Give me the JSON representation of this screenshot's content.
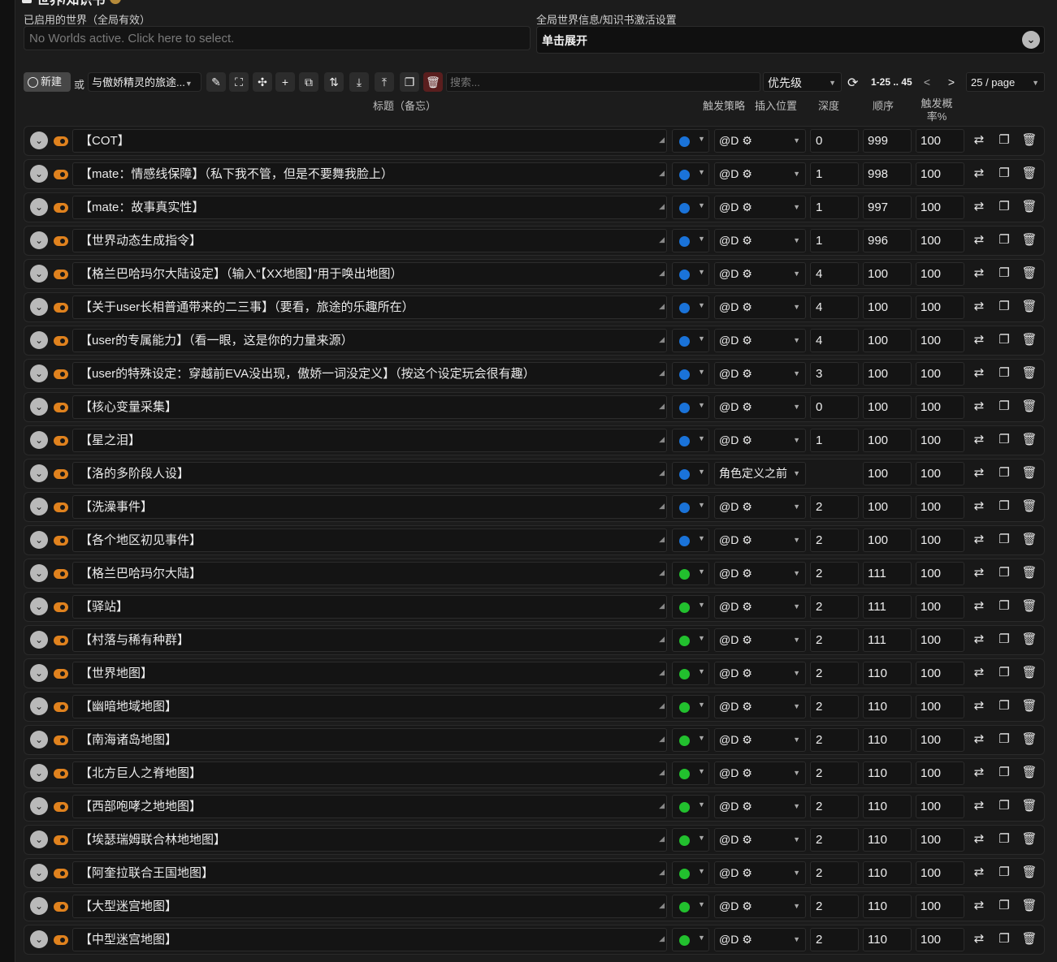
{
  "header": {
    "title_partial": "世界/知识书"
  },
  "active_worlds": {
    "label": "已启用的世界（全局有效）",
    "placeholder": "No Worlds active. Click here to select."
  },
  "global_settings": {
    "label": "全局世界信息/知识书激活设置",
    "expand_text": "单击展开"
  },
  "toolbar": {
    "new_label": "新建",
    "or_label": "或",
    "book_selected": "与傲娇精灵的旅途...",
    "search_placeholder": "搜索...",
    "sort_value": "优先级",
    "range": "1-25 .. 45",
    "prev": "<",
    "next": ">",
    "per_page": "25 / page"
  },
  "columns": {
    "title": "标题（备忘）",
    "strategy": "触发策略",
    "position": "插入位置",
    "depth": "深度",
    "order": "顺序",
    "probability": "触发概率%"
  },
  "colors": {
    "blue": "#1a73d9",
    "green": "#22c02e",
    "accent_orange": "#e0821e"
  },
  "entries": [
    {
      "title": "【COT】",
      "strategy": "blue",
      "position": "@D ⚙",
      "depth": "0",
      "order": "999",
      "probability": "100"
    },
    {
      "title": "【mate：情感线保障】（私下我不管，但是不要舞我脸上）",
      "strategy": "blue",
      "position": "@D ⚙",
      "depth": "1",
      "order": "998",
      "probability": "100"
    },
    {
      "title": "【mate：故事真实性】",
      "strategy": "blue",
      "position": "@D ⚙",
      "depth": "1",
      "order": "997",
      "probability": "100"
    },
    {
      "title": "【世界动态生成指令】",
      "strategy": "blue",
      "position": "@D ⚙",
      "depth": "1",
      "order": "996",
      "probability": "100"
    },
    {
      "title": "【格兰巴哈玛尔大陆设定】（输入“【XX地图】”用于唤出地图）",
      "strategy": "blue",
      "position": "@D ⚙",
      "depth": "4",
      "order": "100",
      "probability": "100"
    },
    {
      "title": "【关于user长相普通带来的二三事】（要看，旅途的乐趣所在）",
      "strategy": "blue",
      "position": "@D ⚙",
      "depth": "4",
      "order": "100",
      "probability": "100"
    },
    {
      "title": "【user的专属能力】（看一眼，这是你的力量来源）",
      "strategy": "blue",
      "position": "@D ⚙",
      "depth": "4",
      "order": "100",
      "probability": "100"
    },
    {
      "title": "【user的特殊设定：穿越前EVA没出现，傲娇一词没定义】（按这个设定玩会很有趣）",
      "strategy": "blue",
      "position": "@D ⚙",
      "depth": "3",
      "order": "100",
      "probability": "100"
    },
    {
      "title": "【核心变量采集】",
      "strategy": "blue",
      "position": "@D ⚙",
      "depth": "0",
      "order": "100",
      "probability": "100"
    },
    {
      "title": "【星之泪】",
      "strategy": "blue",
      "position": "@D ⚙",
      "depth": "1",
      "order": "100",
      "probability": "100"
    },
    {
      "title": "【洛的多阶段人设】",
      "strategy": "blue",
      "position": "角色定义之前",
      "depth": "",
      "order": "100",
      "probability": "100"
    },
    {
      "title": "【洗澡事件】",
      "strategy": "blue",
      "position": "@D ⚙",
      "depth": "2",
      "order": "100",
      "probability": "100"
    },
    {
      "title": "【各个地区初见事件】",
      "strategy": "blue",
      "position": "@D ⚙",
      "depth": "2",
      "order": "100",
      "probability": "100"
    },
    {
      "title": "【格兰巴哈玛尔大陆】",
      "strategy": "green",
      "position": "@D ⚙",
      "depth": "2",
      "order": "111",
      "probability": "100"
    },
    {
      "title": "【驿站】",
      "strategy": "green",
      "position": "@D ⚙",
      "depth": "2",
      "order": "111",
      "probability": "100"
    },
    {
      "title": "【村落与稀有种群】",
      "strategy": "green",
      "position": "@D ⚙",
      "depth": "2",
      "order": "111",
      "probability": "100"
    },
    {
      "title": "【世界地图】",
      "strategy": "green",
      "position": "@D ⚙",
      "depth": "2",
      "order": "110",
      "probability": "100"
    },
    {
      "title": "【幽暗地域地图】",
      "strategy": "green",
      "position": "@D ⚙",
      "depth": "2",
      "order": "110",
      "probability": "100"
    },
    {
      "title": "【南海诸岛地图】",
      "strategy": "green",
      "position": "@D ⚙",
      "depth": "2",
      "order": "110",
      "probability": "100"
    },
    {
      "title": "【北方巨人之脊地图】",
      "strategy": "green",
      "position": "@D ⚙",
      "depth": "2",
      "order": "110",
      "probability": "100"
    },
    {
      "title": "【西部咆哮之地地图】",
      "strategy": "green",
      "position": "@D ⚙",
      "depth": "2",
      "order": "110",
      "probability": "100"
    },
    {
      "title": "【埃瑟瑞姆联合林地地图】",
      "strategy": "green",
      "position": "@D ⚙",
      "depth": "2",
      "order": "110",
      "probability": "100"
    },
    {
      "title": "【阿奎拉联合王国地图】",
      "strategy": "green",
      "position": "@D ⚙",
      "depth": "2",
      "order": "110",
      "probability": "100"
    },
    {
      "title": "【大型迷宫地图】",
      "strategy": "green",
      "position": "@D ⚙",
      "depth": "2",
      "order": "110",
      "probability": "100"
    },
    {
      "title": "【中型迷宫地图】",
      "strategy": "green",
      "position": "@D ⚙",
      "depth": "2",
      "order": "110",
      "probability": "100"
    }
  ]
}
